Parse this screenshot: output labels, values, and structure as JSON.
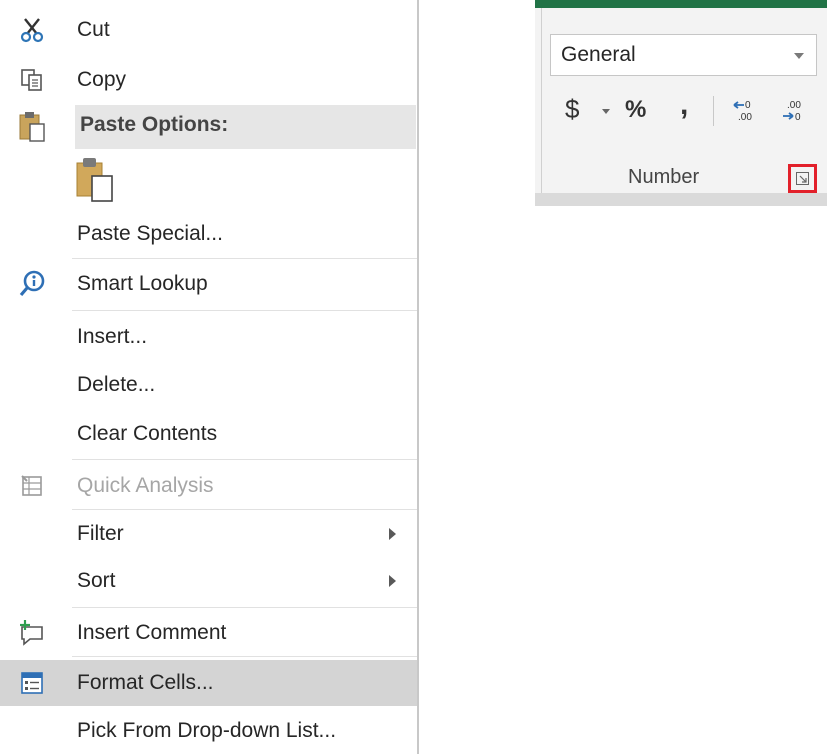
{
  "context_menu": {
    "cut": "Cut",
    "copy": "Copy",
    "paste_options": "Paste Options:",
    "paste_special": "Paste Special...",
    "smart_lookup": "Smart Lookup",
    "insert": "Insert...",
    "delete": "Delete...",
    "clear_contents": "Clear Contents",
    "quick_analysis": "Quick Analysis",
    "filter": "Filter",
    "sort": "Sort",
    "insert_comment": "Insert Comment",
    "format_cells": "Format Cells...",
    "pick_from_list": "Pick From Drop-down List..."
  },
  "ribbon": {
    "number_format": "General",
    "currency_symbol": "$",
    "percent_symbol": "%",
    "comma_symbol": ",",
    "group_label": "Number",
    "accent_color": "#217346",
    "highlight_color": "#e2202a"
  }
}
